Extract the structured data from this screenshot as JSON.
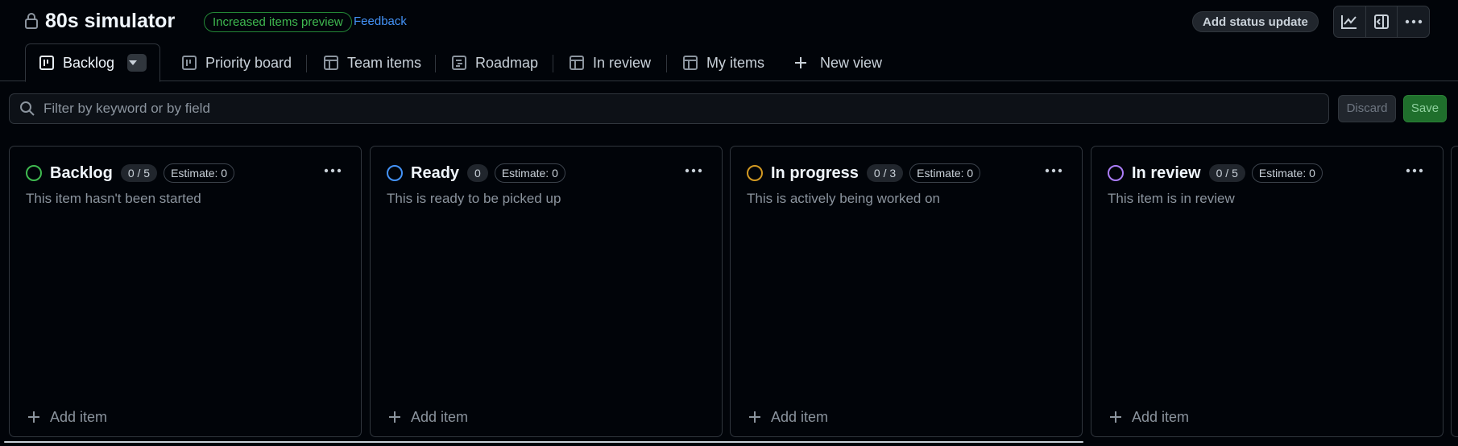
{
  "header": {
    "title": "80s simulator",
    "preview_badge": "Increased items preview",
    "feedback_link": "Feedback",
    "status_button": "Add status update",
    "icons": [
      "lock-icon",
      "graph-icon",
      "sidebar-icon",
      "kebab-icon"
    ]
  },
  "tabs": [
    {
      "label": "Backlog",
      "icon": "board-icon",
      "active": true
    },
    {
      "label": "Priority board",
      "icon": "board-icon"
    },
    {
      "label": "Team items",
      "icon": "table-icon"
    },
    {
      "label": "Roadmap",
      "icon": "roadmap-icon"
    },
    {
      "label": "In review",
      "icon": "table-icon"
    },
    {
      "label": "My items",
      "icon": "table-icon"
    },
    {
      "label": "New view",
      "icon": "plus-icon"
    }
  ],
  "filter": {
    "placeholder": "Filter by keyword or by field",
    "discard_label": "Discard",
    "save_label": "Save"
  },
  "columns": [
    {
      "name": "Backlog",
      "count": "0 / 5",
      "estimate": "Estimate: 0",
      "description": "This item hasn't been started",
      "color": "#3fb950",
      "add_label": "Add item"
    },
    {
      "name": "Ready",
      "count": "0",
      "estimate": "Estimate: 0",
      "description": "This is ready to be picked up",
      "color": "#4493f8",
      "add_label": "Add item"
    },
    {
      "name": "In progress",
      "count": "0 / 3",
      "estimate": "Estimate: 0",
      "description": "This is actively being worked on",
      "color": "#d29922",
      "add_label": "Add item"
    },
    {
      "name": "In review",
      "count": "0 / 5",
      "estimate": "Estimate: 0",
      "description": "This item is in review",
      "color": "#ab7df8",
      "add_label": "Add item"
    }
  ],
  "colors": {
    "background": "#010409",
    "border": "#30363d",
    "accent_green": "#238636",
    "link_blue": "#4493f8"
  }
}
